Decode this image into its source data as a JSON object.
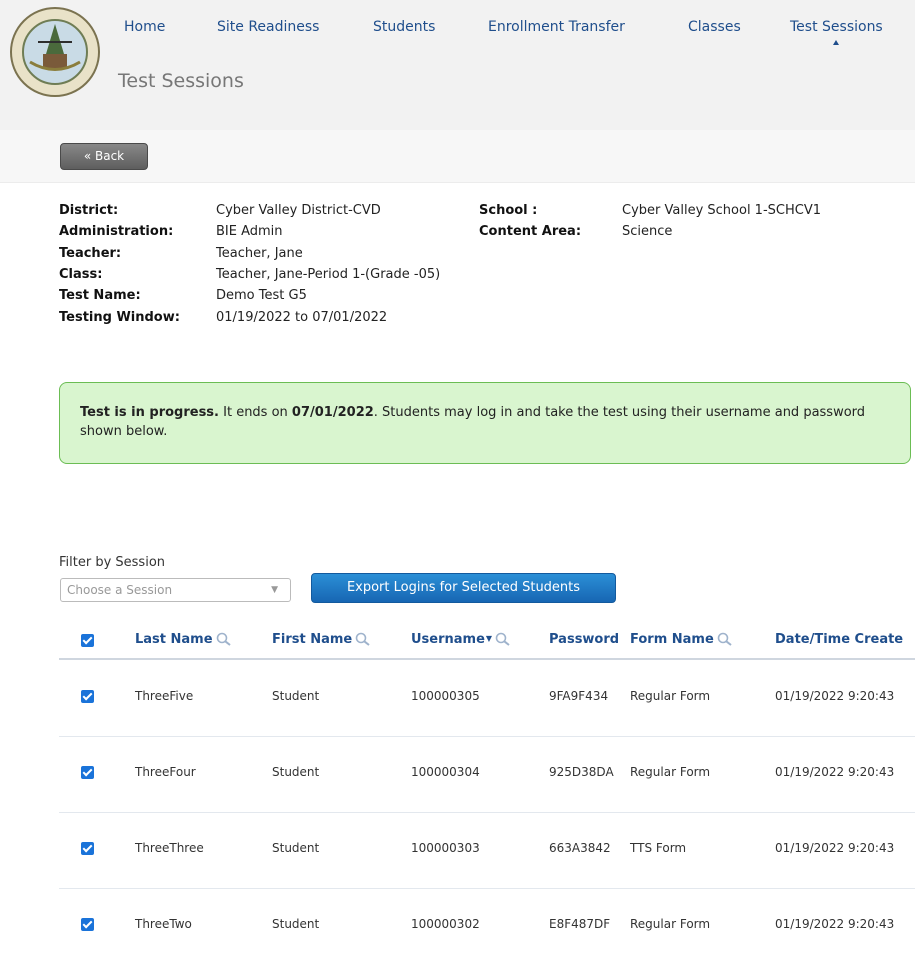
{
  "nav": {
    "items": [
      "Home",
      "Site Readiness",
      "Students",
      "Enrollment Transfer",
      "Classes",
      "Test Sessions"
    ],
    "active": "Test Sessions"
  },
  "logo": {
    "text": "BUREAU OF INDIAN EDUCATION"
  },
  "page_title": "Test Sessions",
  "back_button": "« Back",
  "info": {
    "district_label": "District:",
    "district": "Cyber Valley District-CVD",
    "school_label": "School :",
    "school": "Cyber Valley School 1-SCHCV1",
    "administration_label": "Administration:",
    "administration": "BIE Admin",
    "content_area_label": "Content Area:",
    "content_area": "Science",
    "teacher_label": "Teacher:",
    "teacher": "Teacher, Jane",
    "class_label": "Class:",
    "class": "Teacher, Jane-Period 1-(Grade -05)",
    "test_name_label": "Test Name:",
    "test_name": "Demo Test G5",
    "testing_window_label": "Testing Window:",
    "testing_window": "01/19/2022 to 07/01/2022"
  },
  "status": {
    "bold_lead": "Test is in progress.",
    "text_1": " It ends on ",
    "end_date": "07/01/2022",
    "text_2": ". Students may log in and take the test using their username and password shown below."
  },
  "filter": {
    "label": "Filter by Session",
    "placeholder": "Choose a Session",
    "export_button": "Export Logins for Selected Students"
  },
  "table": {
    "columns": [
      "Last Name",
      "First Name",
      "Username",
      "Password",
      "Form Name",
      "Date/Time Create"
    ],
    "rows": [
      {
        "last": "ThreeFive",
        "first": "Student",
        "username": "100000305",
        "password": "9FA9F434",
        "form": "Regular Form",
        "date": "01/19/2022 9:20:43"
      },
      {
        "last": "ThreeFour",
        "first": "Student",
        "username": "100000304",
        "password": "925D38DA",
        "form": "Regular Form",
        "date": "01/19/2022 9:20:43"
      },
      {
        "last": "ThreeThree",
        "first": "Student",
        "username": "100000303",
        "password": "663A3842",
        "form": "TTS Form",
        "date": "01/19/2022 9:20:43"
      },
      {
        "last": "ThreeTwo",
        "first": "Student",
        "username": "100000302",
        "password": "E8F487DF",
        "form": "Regular Form",
        "date": "01/19/2022 9:20:43"
      }
    ]
  },
  "colors": {
    "nav_text": "#1f4e8c",
    "status_bg": "#d9f5cf",
    "status_border": "#6bbd54",
    "export_button": "#1766b3",
    "checkbox": "#1a73d9"
  }
}
